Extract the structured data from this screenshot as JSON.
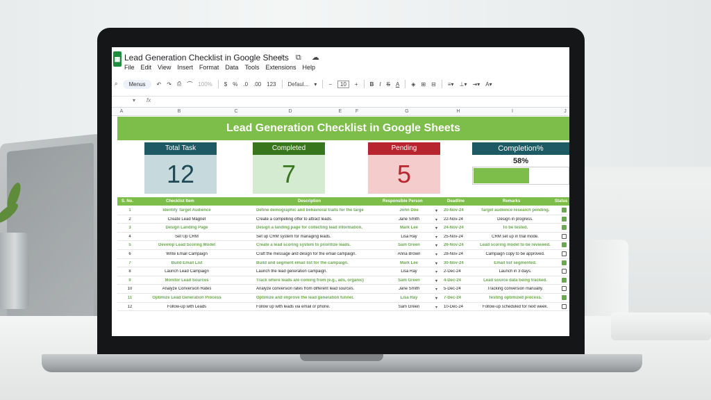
{
  "app": {
    "title": "Lead Generation Checklist in Google Sheets",
    "title_icons": "☆ ⧉ ☁",
    "menus": [
      "File",
      "Edit",
      "View",
      "Insert",
      "Format",
      "Data",
      "Tools",
      "Extensions",
      "Help"
    ]
  },
  "toolbar": {
    "menus_label": "Menus",
    "zoom": "100%",
    "currency": "$",
    "percent": "%",
    "dec_decrease": ".0",
    "dec_increase": ".00",
    "number_format": "123",
    "font": "Defaul...",
    "font_size": "10",
    "bold": "B",
    "italic": "I",
    "strike": "S",
    "text_color": "A"
  },
  "formula": {
    "fx": "fx"
  },
  "columns": [
    "A",
    "B",
    "C",
    "D",
    "E",
    "F",
    "G",
    "H",
    "I",
    "J"
  ],
  "banner": {
    "title": "Lead Generation Checklist in Google Sheets"
  },
  "kpis": {
    "total": {
      "label": "Total Task",
      "value": "12"
    },
    "completed": {
      "label": "Completed",
      "value": "7"
    },
    "pending": {
      "label": "Pending",
      "value": "5"
    },
    "completion": {
      "label": "Completion%",
      "value": "58%",
      "fraction": 0.58
    }
  },
  "colors": {
    "green": "#7dbd4a",
    "teal": "#1e5a64",
    "darkgreen": "#38761d",
    "red": "#b7262e"
  },
  "table": {
    "headers": {
      "sno": "S. No.",
      "item": "Checklist Item",
      "desc": "Description",
      "person": "Responsible Person",
      "deadline": "Deadline",
      "remarks": "Remarks",
      "status": "Status"
    },
    "rows": [
      {
        "sno": "1",
        "item": "Identify Target Audience",
        "desc": "Define demographic and behavioral traits for the targe",
        "person": "John Doe",
        "deadline": "20-Nov-24",
        "remarks": "Target audience research pending.",
        "done": true
      },
      {
        "sno": "2",
        "item": "Create Lead Magnet",
        "desc": "Create a compelling offer to attract leads.",
        "person": "Jane Smith",
        "deadline": "22-Nov-24",
        "remarks": "Design in progress.",
        "done": true
      },
      {
        "sno": "3",
        "item": "Design Landing Page",
        "desc": "Design a landing page for collecting lead information.",
        "person": "Mark Lee",
        "deadline": "24-Nov-24",
        "remarks": "To be tested.",
        "done": true
      },
      {
        "sno": "4",
        "item": "Set Up CRM",
        "desc": "Set up CRM system for managing leads.",
        "person": "Lisa Ray",
        "deadline": "25-Nov-24",
        "remarks": "CRM set up in trial mode.",
        "done": false
      },
      {
        "sno": "5",
        "item": "Develop Lead Scoring Model",
        "desc": "Create a lead scoring system to prioritize leads.",
        "person": "Sam Green",
        "deadline": "26-Nov-24",
        "remarks": "Lead scoring model to be reviewed.",
        "done": true
      },
      {
        "sno": "6",
        "item": "Write Email Campaign",
        "desc": "Craft the message and design for the email campaign.",
        "person": "Anna Brown",
        "deadline": "28-Nov-24",
        "remarks": "Campaign copy to be approved.",
        "done": false
      },
      {
        "sno": "7",
        "item": "Build Email List",
        "desc": "Build and segment email list for the campaign.",
        "person": "Mark Lee",
        "deadline": "30-Nov-24",
        "remarks": "Email list segmented.",
        "done": true
      },
      {
        "sno": "8",
        "item": "Launch Lead Campaign",
        "desc": "Launch the lead generation campaign.",
        "person": "Lisa Ray",
        "deadline": "2-Dec-24",
        "remarks": "Launch in 3 days.",
        "done": false
      },
      {
        "sno": "9",
        "item": "Monitor Lead Sources",
        "desc": "Track where leads are coming from (e.g., ads, organic)",
        "person": "Sam Green",
        "deadline": "4-Dec-24",
        "remarks": "Lead source data being tracked.",
        "done": true
      },
      {
        "sno": "10",
        "item": "Analyze Conversion Rates",
        "desc": "Analyze conversion rates from different lead sources.",
        "person": "Jane Smith",
        "deadline": "5-Dec-24",
        "remarks": "Tracking conversion manually.",
        "done": false
      },
      {
        "sno": "11",
        "item": "Optimize Lead Generation Process",
        "desc": "Optimize and improve the lead generation funnel.",
        "person": "Lisa Ray",
        "deadline": "7-Dec-24",
        "remarks": "Testing optimized process.",
        "done": true
      },
      {
        "sno": "12",
        "item": "Follow-up with Leads",
        "desc": "Follow up with leads via email or phone.",
        "person": "Sam Green",
        "deadline": "10-Dec-24",
        "remarks": "Follow-up scheduled for next week.",
        "done": false
      }
    ]
  }
}
